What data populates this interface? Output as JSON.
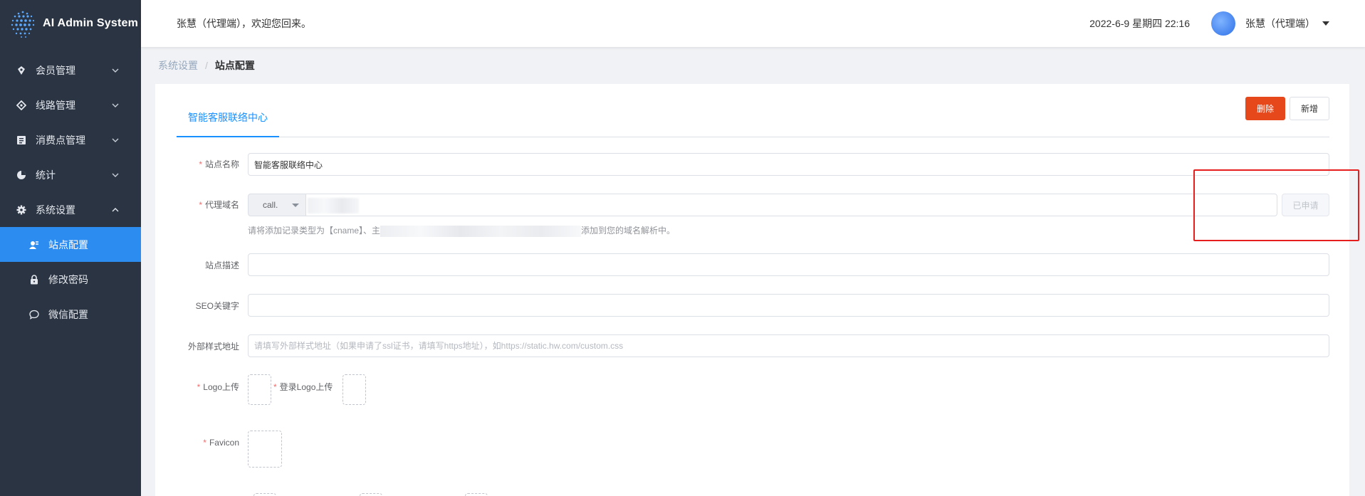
{
  "app": {
    "title": "AI Admin System"
  },
  "sidebar": {
    "items": [
      {
        "label": "会员管理",
        "icon": "member-icon",
        "expanded": false
      },
      {
        "label": "线路管理",
        "icon": "route-icon",
        "expanded": false
      },
      {
        "label": "消费点管理",
        "icon": "consume-icon",
        "expanded": false
      },
      {
        "label": "统计",
        "icon": "pie-chart-icon",
        "expanded": false
      },
      {
        "label": "系统设置",
        "icon": "gear-icon",
        "expanded": true
      }
    ],
    "subitems": [
      {
        "label": "站点配置",
        "icon": "site-icon",
        "active": true
      },
      {
        "label": "修改密码",
        "icon": "lock-icon",
        "active": false
      },
      {
        "label": "微信配置",
        "icon": "chat-icon",
        "active": false
      }
    ]
  },
  "header": {
    "welcome": "张慧（代理端），欢迎您回来。",
    "datetime": "2022-6-9 星期四 22:16",
    "user": "张慧（代理端）"
  },
  "breadcrumb": {
    "first": "系统设置",
    "sep": "/",
    "last": "站点配置"
  },
  "tabs": [
    {
      "label": "智能客服联络中心",
      "active": true
    }
  ],
  "actions": {
    "delete_label": "删除",
    "add_label": "新增"
  },
  "form": {
    "site_name": {
      "label": "站点名称",
      "value": "智能客服联络中心",
      "required": true
    },
    "proxy_domain": {
      "label": "代理域名",
      "prefix": "call.",
      "value": "",
      "required": true,
      "applied_label": "已申请",
      "hint_start": "请将添加记录类型为【cname】、主",
      "hint_end": "添加到您的域名解析中。"
    },
    "site_desc": {
      "label": "站点描述",
      "value": ""
    },
    "seo_keywords": {
      "label": "SEO关键字",
      "value": ""
    },
    "external_style": {
      "label": "外部样式地址",
      "value": "",
      "placeholder": "请填写外部样式地址（如果申请了ssl证书，请填写https地址），如https://static.hw.com/custom.css"
    },
    "logo_upload": {
      "label": "Logo上传",
      "required": true
    },
    "login_logo_upload": {
      "label": "登录Logo上传",
      "required": true
    },
    "favicon": {
      "label": "Favicon",
      "required": true
    }
  },
  "colors": {
    "sidebar_bg": "#2b3442",
    "accent": "#2d8cf0",
    "danger": "#e6471b",
    "highlight": "#e61e1e"
  }
}
